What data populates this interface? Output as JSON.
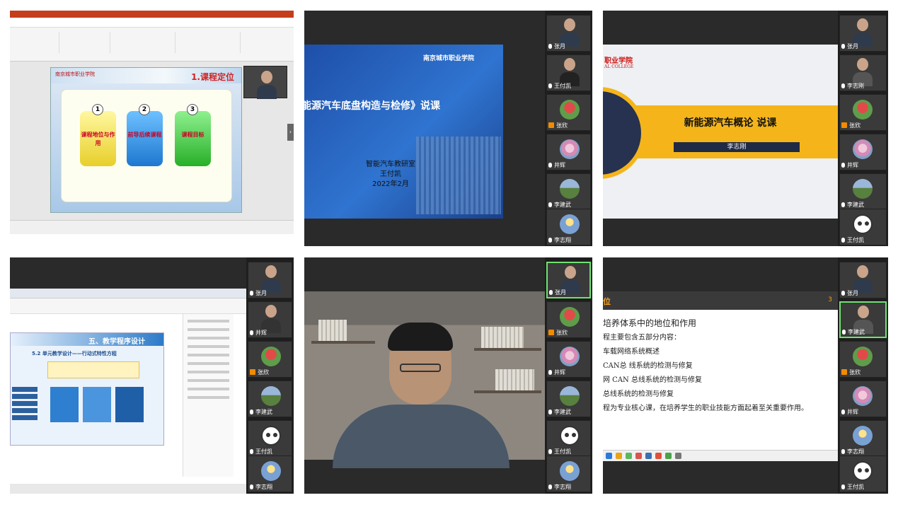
{
  "panel1": {
    "slide_title": "1.课程定位",
    "logo": "南京城市职业学院",
    "tiles": [
      {
        "num": "1",
        "label": "课程地位与作用"
      },
      {
        "num": "2",
        "label": "前导后续课程"
      },
      {
        "num": "3",
        "label": "课程目标"
      }
    ]
  },
  "panel2": {
    "logo": "南京城市职业学院",
    "title": "能源汽车底盘构造与检修》说课",
    "sub1": "智能汽车教研室",
    "sub2": "王付凯",
    "sub3": "2022年2月",
    "participants": [
      "张月",
      "王付凯",
      "张欣",
      "井辉",
      "李建武",
      "李志翔"
    ]
  },
  "panel3": {
    "logo": "职业学院",
    "logo_sub": "AL COLLEGE",
    "title": "新能源汽车概论 说课",
    "presenter": "李志刚",
    "participants": [
      "张月",
      "李志刚",
      "张欣",
      "井辉",
      "李建武",
      "王付凯"
    ]
  },
  "panel4": {
    "slide_title": "五、教学程序设计",
    "slide_sub": "5.2 单元教学设计——行动式特性方程",
    "participants": [
      "张月",
      "井辉",
      "张欣",
      "李建武",
      "王付凯",
      "李志翔"
    ]
  },
  "panel5": {
    "participants": [
      "张月",
      "张欣",
      "井辉",
      "李建武",
      "王付凯",
      "李志翔"
    ]
  },
  "panel6": {
    "header": "位",
    "page": "3",
    "lines": [
      "培养体系中的地位和作用",
      "程主要包含五部分内容：",
      "车载网络系统概述",
      "CAN总 线系统的检测与修复",
      "网 CAN 总线系统的检测与修复",
      "总线系统的检测与修复",
      "程为专业核心课，在培养学生的职业技能方面起着至关重要作用。"
    ],
    "participants": [
      "张月",
      "李建武",
      "张欣",
      "井辉",
      "李志翔",
      "王付凯"
    ]
  }
}
